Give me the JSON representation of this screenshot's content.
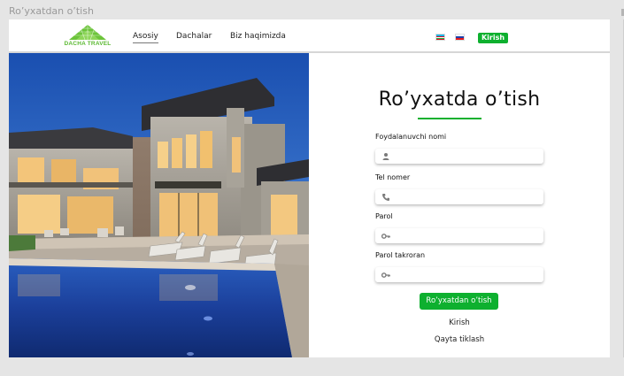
{
  "frame": {
    "label": "Ro’yxatdan o’tish"
  },
  "header": {
    "logo_text": "DACHA TRAVEL",
    "nav": [
      {
        "label": "Asosiy",
        "active": true
      },
      {
        "label": "Dachalar",
        "active": false
      },
      {
        "label": "Biz haqimizda",
        "active": false
      }
    ],
    "languages": [
      "uz-flag-icon",
      "ru-flag-icon"
    ],
    "login_label": "Kirish"
  },
  "hero": {
    "image": "luxury-house-with-pool"
  },
  "form": {
    "title": "Ro’yxatda  o’tish",
    "fields": [
      {
        "label": "Foydalanuvchi nomi",
        "icon": "user-icon",
        "value": "",
        "placeholder": ""
      },
      {
        "label": "Tel nomer",
        "icon": "phone-icon",
        "value": "",
        "placeholder": ""
      },
      {
        "label": "Parol",
        "icon": "key-icon",
        "value": "",
        "placeholder": ""
      },
      {
        "label": "Parol takroran",
        "icon": "key-icon",
        "value": "",
        "placeholder": ""
      }
    ],
    "submit_label": "Ro’yxatdan o’tish",
    "login_link": "Kirish",
    "recover_link": "Qayta tiklash"
  },
  "colors": {
    "accent": "#0eb02f",
    "logo_green": "#5bb932",
    "page_bg": "#e5e5e5"
  }
}
